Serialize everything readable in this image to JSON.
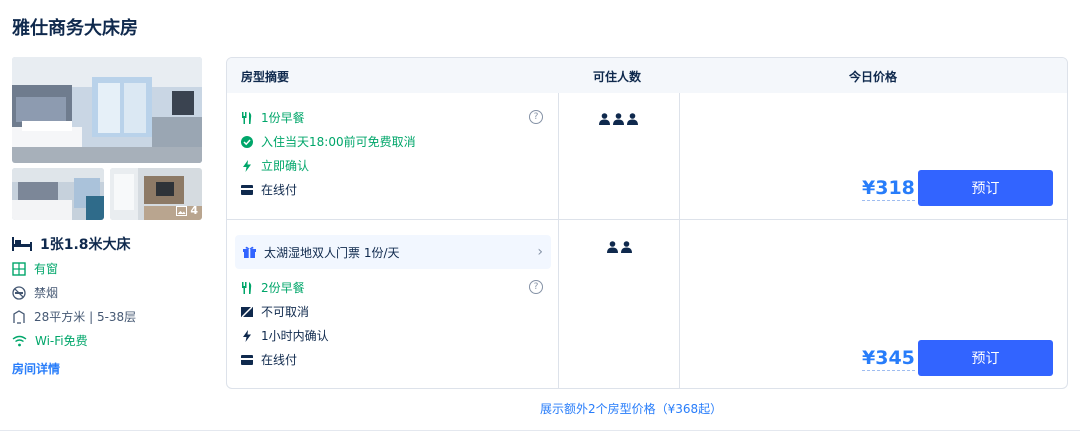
{
  "room": {
    "title": "雅仕商务大床房",
    "photo_count": "4",
    "bed": "1张1.8米大床",
    "facilities": [
      "有窗",
      "禁烟",
      "28平方米 | 5-38层",
      "Wi-Fi免费"
    ],
    "detail_link": "房间详情"
  },
  "table": {
    "headers": {
      "summary": "房型摘要",
      "people": "可住人数",
      "price": "今日价格"
    },
    "rows": [
      {
        "features": [
          "1份早餐",
          "入住当天18:00前可免费取消",
          "立即确认",
          "在线付"
        ],
        "people": 3,
        "price": "¥318",
        "book_label": "预订"
      },
      {
        "gift": "太湖湿地双人门票 1份/天",
        "features": [
          "2份早餐",
          "不可取消",
          "1小时内确认",
          "在线付"
        ],
        "people": 2,
        "price": "¥345",
        "book_label": "预订"
      }
    ]
  },
  "more_link": "展示额外2个房型价格（¥368起）",
  "colors": {
    "accent": "#287dfa",
    "button": "#3264ff",
    "green": "#00a66a",
    "text": "#0f294d"
  }
}
